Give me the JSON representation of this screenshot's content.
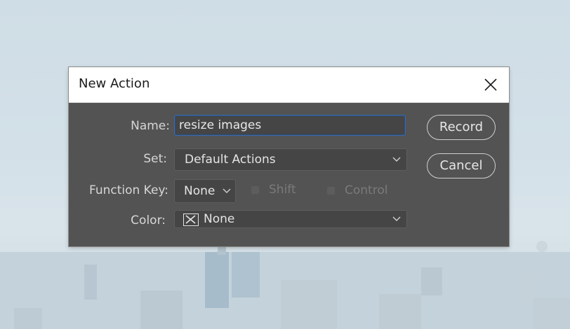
{
  "dialog": {
    "title": "New Action",
    "close_icon": "close-icon"
  },
  "form": {
    "name_label": "Name:",
    "name_value": "resize images",
    "set_label": "Set:",
    "set_value": "Default Actions",
    "function_key_label": "Function Key:",
    "function_key_value": "None",
    "shift_label": "Shift",
    "control_label": "Control",
    "color_label": "Color:",
    "color_value": "None",
    "color_icon": "color-none-x-icon",
    "shift_checked": false,
    "control_checked": false
  },
  "buttons": {
    "record": "Record",
    "cancel": "Cancel"
  },
  "colors": {
    "dialog_bg": "#535353",
    "field_bg": "#454545",
    "focus_border": "#3b6aa8",
    "disabled_text": "#7a7a7a"
  }
}
